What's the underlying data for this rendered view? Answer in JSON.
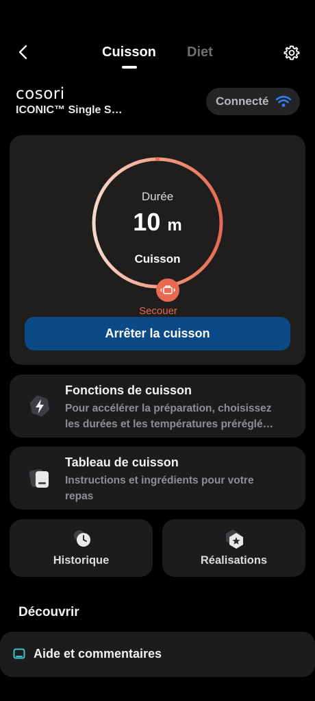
{
  "header": {
    "tabs": [
      {
        "label": "Cuisson",
        "active": true
      },
      {
        "label": "Diet",
        "active": false
      }
    ],
    "back_icon": "chevron-left-icon",
    "settings_icon": "gear-icon"
  },
  "device": {
    "brand": "cosori",
    "model": "ICONIC™ Single S…",
    "status": "Connecté",
    "status_icon": "wifi-icon",
    "wifi_color": "#2d7ff0"
  },
  "cooking": {
    "duration_label": "Durée",
    "duration_value": "10",
    "duration_unit": "m",
    "mode_label": "Cuisson",
    "progress_fraction": 0.03,
    "shake_label": "Secouer",
    "stop_button": "Arrêter la cuisson",
    "accent_color": "#e86a52",
    "button_color": "#0b4a86"
  },
  "features": [
    {
      "title": "Fonctions de cuisson",
      "desc_line1": "Pour accélérer la préparation, choisissez",
      "desc_line2": "les durées et les températures préréglé…",
      "icon": "lightning-icon"
    },
    {
      "title": "Tableau de cuisson",
      "desc_line1": "Instructions et ingrédients pour votre",
      "desc_line2": "repas",
      "icon": "recipe-book-icon"
    }
  ],
  "shortcuts": [
    {
      "label": "Historique",
      "icon": "history-clock-icon"
    },
    {
      "label": "Réalisations",
      "icon": "achievement-star-icon"
    }
  ],
  "discover": {
    "title": "Découvrir",
    "items": [
      {
        "label": "Aide et commentaires",
        "icon": "help-chat-icon",
        "icon_color": "#3cc6c6"
      }
    ]
  }
}
